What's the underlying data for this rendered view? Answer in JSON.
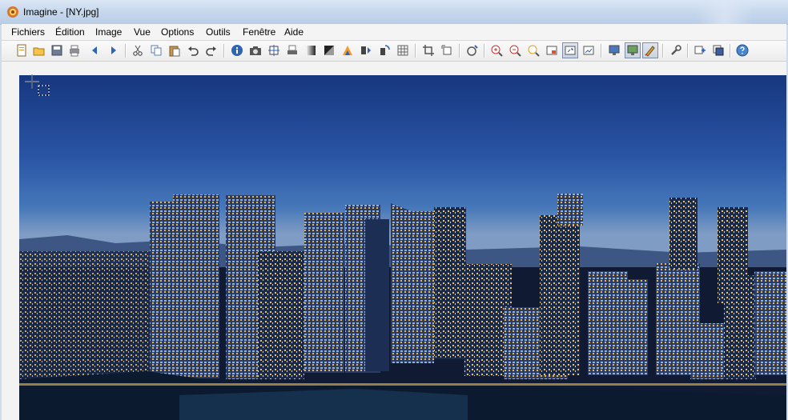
{
  "window": {
    "title": "Imagine - [NY.jpg]"
  },
  "menu": [
    {
      "label": "Fichiers"
    },
    {
      "label": "Édition"
    },
    {
      "label": "Image"
    },
    {
      "label": "Vue"
    },
    {
      "label": "Options"
    },
    {
      "label": "Outils"
    },
    {
      "label": "Fenêtre"
    },
    {
      "label": "Aide"
    }
  ],
  "toolbar": {
    "buttons": [
      {
        "icon": "new-file-icon"
      },
      {
        "icon": "open-folder-icon"
      },
      {
        "icon": "save-icon"
      },
      {
        "icon": "print-icon"
      },
      {
        "icon": "previous-icon"
      },
      {
        "icon": "next-icon"
      },
      {
        "icon": "cut-icon"
      },
      {
        "icon": "copy-icon"
      },
      {
        "icon": "paste-icon"
      },
      {
        "icon": "undo-icon"
      },
      {
        "icon": "redo-icon"
      },
      {
        "icon": "info-icon"
      },
      {
        "icon": "camera-icon"
      },
      {
        "icon": "resize-icon"
      },
      {
        "icon": "scanner-icon"
      },
      {
        "icon": "grayscale-icon"
      },
      {
        "icon": "contrast-icon"
      },
      {
        "icon": "color-adjust-icon"
      },
      {
        "icon": "flip-icon"
      },
      {
        "icon": "rotate-icon"
      },
      {
        "icon": "grid-icon"
      },
      {
        "icon": "crop-icon"
      },
      {
        "icon": "canvas-icon"
      },
      {
        "icon": "effect-icon"
      },
      {
        "icon": "zoom-in-icon"
      },
      {
        "icon": "zoom-out-icon"
      },
      {
        "icon": "zoom-fit-icon"
      },
      {
        "icon": "window-icon"
      },
      {
        "icon": "fit-image-icon"
      },
      {
        "icon": "stretch-icon"
      },
      {
        "icon": "monitor-icon"
      },
      {
        "icon": "slideshow-icon"
      },
      {
        "icon": "paint-tool-icon"
      },
      {
        "icon": "settings-wrench-icon"
      },
      {
        "icon": "plugins-icon"
      },
      {
        "icon": "batch-icon"
      },
      {
        "icon": "help-icon"
      }
    ]
  },
  "colors": {
    "accent": "#2e63b8",
    "sky_top": "#1b3d86",
    "city_lights": "#f2c35a"
  }
}
